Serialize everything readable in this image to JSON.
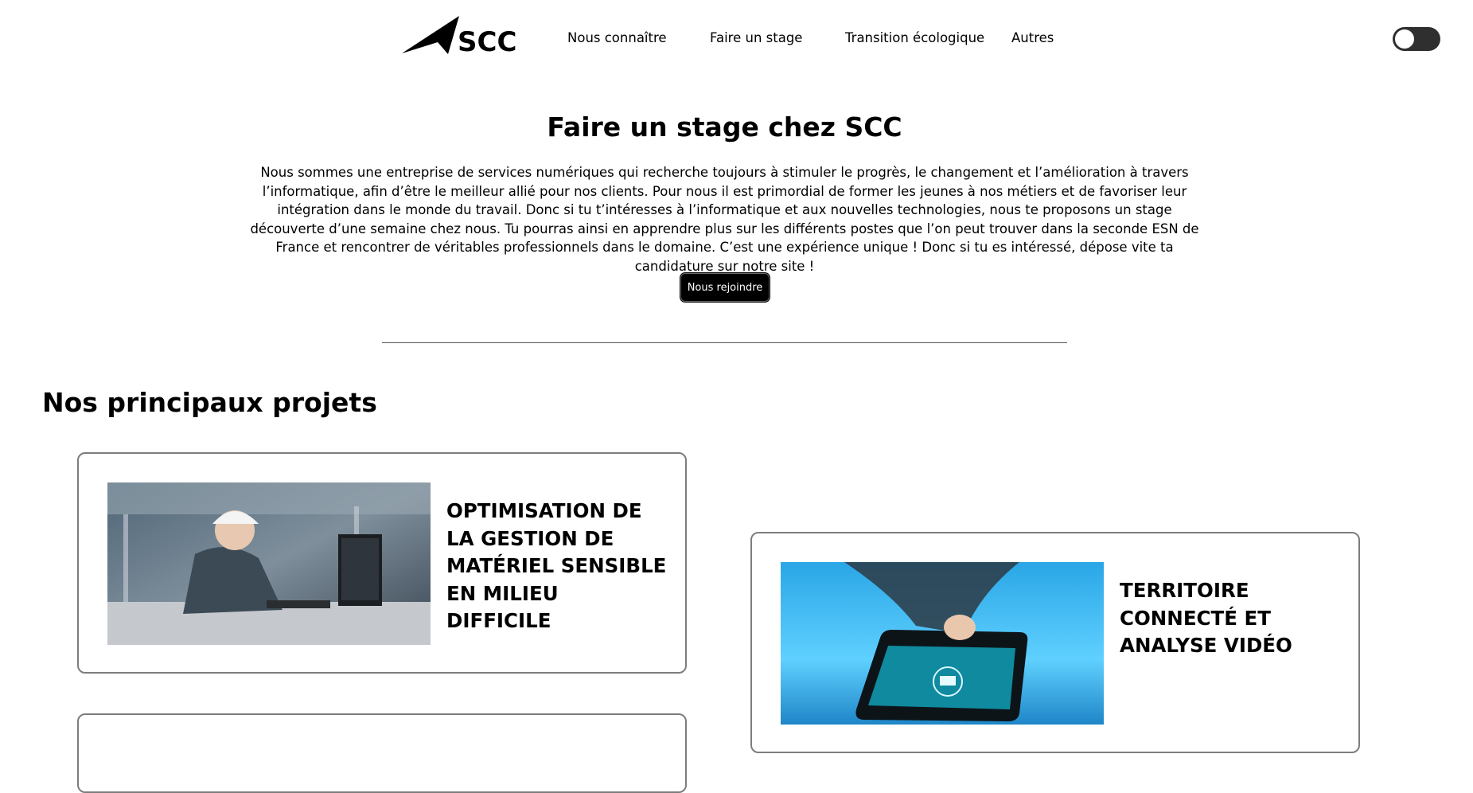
{
  "header": {
    "logo_text": "SCC",
    "nav": [
      "Nous connaître",
      "Faire un stage",
      "Transition écologique",
      "Autres"
    ],
    "theme_toggle": "dark-mode-toggle"
  },
  "hero": {
    "title": "Faire un stage chez SCC",
    "description": "Nous sommes une entreprise de services numériques qui recherche toujours à stimuler le progrès, le changement et l’amélioration à travers l’informatique, afin d’être le meilleur allié pour nos clients. Pour nous il est primordial de former les jeunes à nos métiers et de favoriser leur intégration dans le monde du travail. Donc si tu t’intéresses à l’informatique et aux nouvelles technologies, nous te proposons un stage découverte d’une semaine chez nous. Tu pourras ainsi en apprendre plus sur les différents postes que l’on peut trouver dans la seconde ESN de France et rencontrer de véritables professionnels dans le domaine. C’est une expérience unique ! Donc si tu es intéressé, dépose vite ta candidature sur notre site !",
    "cta_label": "Nous rejoindre"
  },
  "projects": {
    "title": "Nos principaux projets",
    "items": [
      {
        "title": "OPTIMISATION DE LA GESTION DE MATÉRIEL SENSIBLE EN MILIEU DIFFICILE",
        "image": "engineer-at-computer-photo"
      },
      {
        "title": "TERRITOIRE CONNECTÉ ET ANALYSE VIDÉO",
        "image": "hand-touching-smartphone-photo"
      }
    ]
  },
  "colors": {
    "background": "#ffffff",
    "text": "#000000",
    "button": "#000000",
    "card_border": "#7d7d7d",
    "toggle": "#2f2f2f"
  }
}
